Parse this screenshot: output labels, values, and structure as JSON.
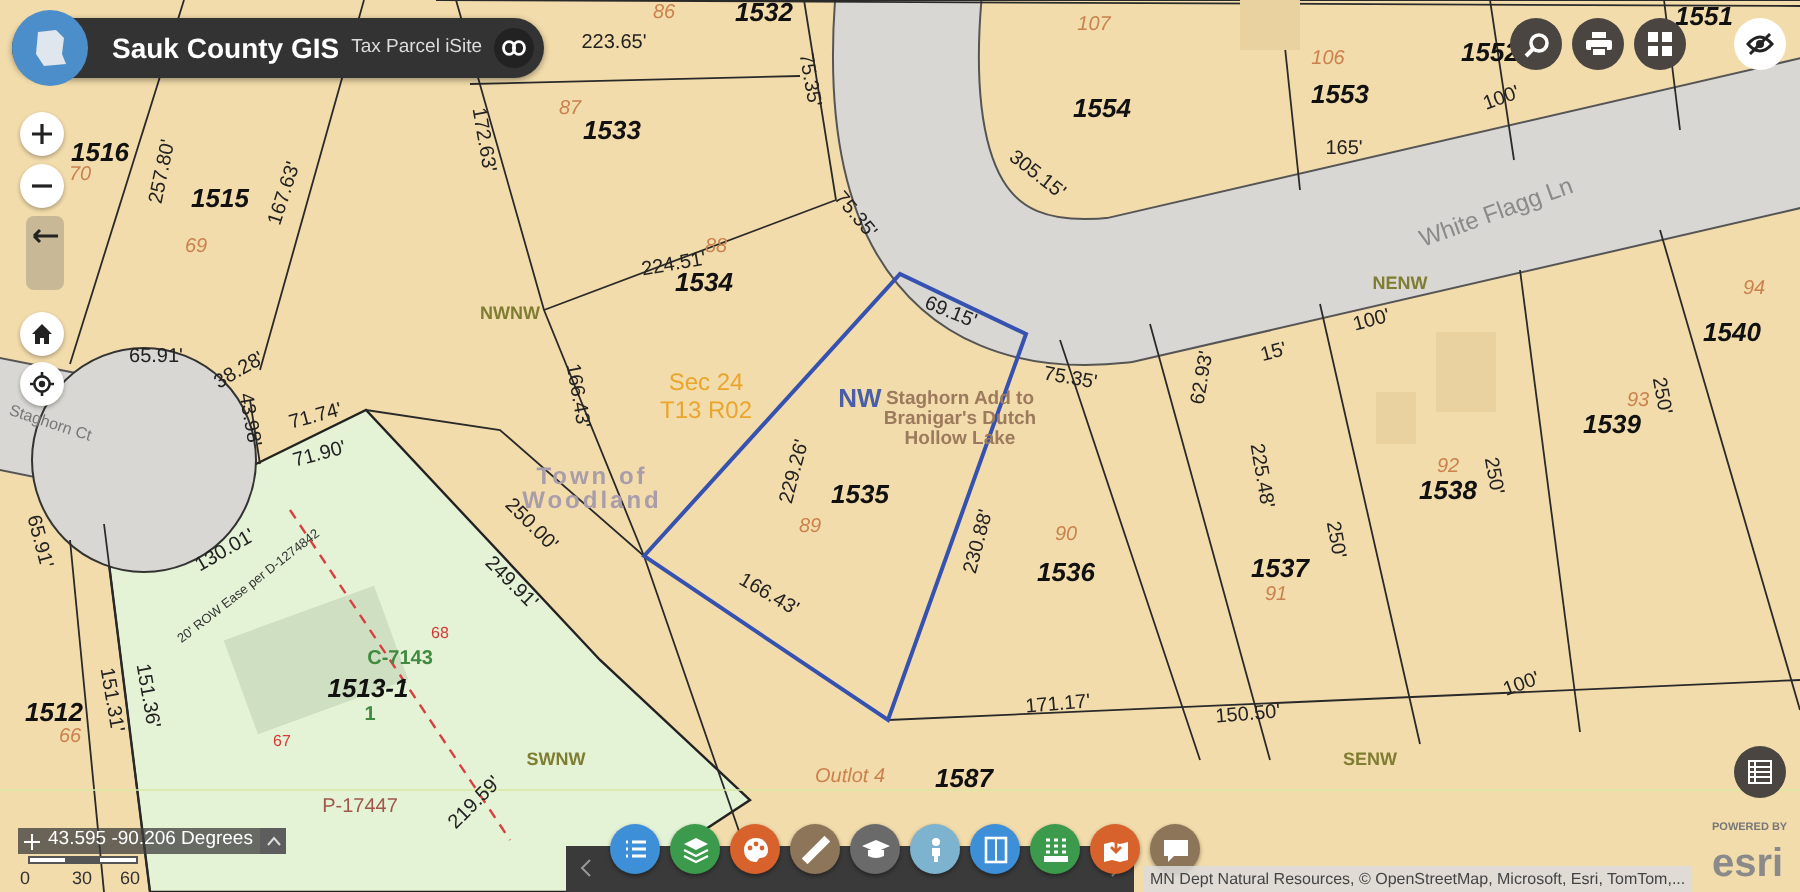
{
  "app": {
    "title": "Sauk County GIS",
    "subtitle": "Tax Parcel iSite"
  },
  "map_labels": [
    {
      "text": "86",
      "kind": "lot"
    },
    {
      "text": "1532",
      "kind": "parcel"
    },
    {
      "text": "223.65'",
      "kind": "dimension"
    },
    {
      "text": "107",
      "kind": "lot"
    },
    {
      "text": "1554",
      "kind": "parcel"
    },
    {
      "text": "106",
      "kind": "lot"
    },
    {
      "text": "1553",
      "kind": "parcel"
    },
    {
      "text": "1552",
      "kind": "parcel"
    },
    {
      "text": "100'",
      "kind": "dimension"
    },
    {
      "text": "1551",
      "kind": "parcel"
    },
    {
      "text": "1516",
      "kind": "parcel"
    },
    {
      "text": "70",
      "kind": "lot"
    },
    {
      "text": "257.80'",
      "kind": "dimension"
    },
    {
      "text": "1515",
      "kind": "parcel"
    },
    {
      "text": "167.63'",
      "kind": "dimension"
    },
    {
      "text": "69",
      "kind": "lot"
    },
    {
      "text": "172.63'",
      "kind": "dimension"
    },
    {
      "text": "87",
      "kind": "lot"
    },
    {
      "text": "1533",
      "kind": "parcel"
    },
    {
      "text": "75.35'",
      "kind": "dimension"
    },
    {
      "text": "305.15'",
      "kind": "dimension"
    },
    {
      "text": "165'",
      "kind": "dimension"
    },
    {
      "text": "White Flagg Ln",
      "kind": "road"
    },
    {
      "text": "75.35'",
      "kind": "dimension"
    },
    {
      "text": "224.51'",
      "kind": "dimension"
    },
    {
      "text": "88",
      "kind": "lot"
    },
    {
      "text": "1534",
      "kind": "parcel"
    },
    {
      "text": "NWNW",
      "kind": "quarter"
    },
    {
      "text": "69.15'",
      "kind": "dimension"
    },
    {
      "text": "NENW",
      "kind": "quarter"
    },
    {
      "text": "100'",
      "kind": "dimension"
    },
    {
      "text": "94",
      "kind": "lot"
    },
    {
      "text": "1540",
      "kind": "parcel"
    },
    {
      "text": "65.91'",
      "kind": "dimension"
    },
    {
      "text": "38.28'",
      "kind": "dimension"
    },
    {
      "text": "Staghorn Ct",
      "kind": "street"
    },
    {
      "text": "43.98'",
      "kind": "dimension"
    },
    {
      "text": "71.74'",
      "kind": "dimension"
    },
    {
      "text": "71.90'",
      "kind": "dimension"
    },
    {
      "text": "166.43'",
      "kind": "dimension"
    },
    {
      "text": "Town of Woodland",
      "kind": "town"
    },
    {
      "text": "Sec 24",
      "kind": "section"
    },
    {
      "text": "T13 R02",
      "kind": "section"
    },
    {
      "text": "NW",
      "kind": "direction"
    },
    {
      "text": "Staghorn Add to Branigar's Dutch Hollow Lake",
      "kind": "plat"
    },
    {
      "text": "75.35'",
      "kind": "dimension"
    },
    {
      "text": "62.93'",
      "kind": "dimension"
    },
    {
      "text": "15'",
      "kind": "dimension"
    },
    {
      "text": "93",
      "kind": "lot"
    },
    {
      "text": "250'",
      "kind": "dimension"
    },
    {
      "text": "1539",
      "kind": "parcel"
    },
    {
      "text": "229.26'",
      "kind": "dimension"
    },
    {
      "text": "1535",
      "kind": "parcel"
    },
    {
      "text": "92",
      "kind": "lot"
    },
    {
      "text": "250'",
      "kind": "dimension"
    },
    {
      "text": "1538",
      "kind": "parcel"
    },
    {
      "text": "89",
      "kind": "lot"
    },
    {
      "text": "65.91'",
      "kind": "dimension"
    },
    {
      "text": "130.01'",
      "kind": "dimension"
    },
    {
      "text": "20' ROW Ease per D-1274842",
      "kind": "easement"
    },
    {
      "text": "250.00'",
      "kind": "dimension"
    },
    {
      "text": "249.91'",
      "kind": "dimension"
    },
    {
      "text": "90",
      "kind": "lot"
    },
    {
      "text": "230.88'",
      "kind": "dimension"
    },
    {
      "text": "1536",
      "kind": "parcel"
    },
    {
      "text": "225.48'",
      "kind": "dimension"
    },
    {
      "text": "250'",
      "kind": "dimension"
    },
    {
      "text": "1537",
      "kind": "parcel"
    },
    {
      "text": "91",
      "kind": "lot"
    },
    {
      "text": "166.43'",
      "kind": "dimension"
    },
    {
      "text": "68",
      "kind": "lot_red"
    },
    {
      "text": "C-7143",
      "kind": "csm"
    },
    {
      "text": "1513-1",
      "kind": "parcel"
    },
    {
      "text": "1",
      "kind": "csm"
    },
    {
      "text": "1512",
      "kind": "parcel"
    },
    {
      "text": "151.31'",
      "kind": "dimension"
    },
    {
      "text": "151.36'",
      "kind": "dimension"
    },
    {
      "text": "66",
      "kind": "lot"
    },
    {
      "text": "67",
      "kind": "lot_red"
    },
    {
      "text": "171.17'",
      "kind": "dimension"
    },
    {
      "text": "150.50'",
      "kind": "dimension"
    },
    {
      "text": "100'",
      "kind": "dimension"
    },
    {
      "text": "SWNW",
      "kind": "quarter"
    },
    {
      "text": "SENW",
      "kind": "quarter"
    },
    {
      "text": "Outlot 4",
      "kind": "outlot"
    },
    {
      "text": "1587",
      "kind": "parcel"
    },
    {
      "text": "P-17447",
      "kind": "plat_doc"
    },
    {
      "text": "219.59'",
      "kind": "dimension"
    }
  ],
  "coordinates": {
    "text": "43.595 -90.206 Degrees"
  },
  "scale": {
    "labels": [
      "0",
      "30",
      "60"
    ]
  },
  "toolbar": {
    "tools": [
      {
        "color": "#3d8fd8"
      },
      {
        "color": "#3c9a4c"
      },
      {
        "color": "#d8622c"
      },
      {
        "color": "#8c7558"
      },
      {
        "color": "#6a6a6a"
      },
      {
        "color": "#7eb3d0"
      },
      {
        "color": "#3d8fd8"
      },
      {
        "color": "#3c9a4c"
      },
      {
        "color": "#d8622c"
      },
      {
        "color": "#8c7558"
      }
    ]
  },
  "attribution": "MN Dept Natural Resources, © OpenStreetMap, Microsoft, Esri, TomTom,...",
  "esri": {
    "powered": "POWERED BY",
    "brand": "esri"
  }
}
